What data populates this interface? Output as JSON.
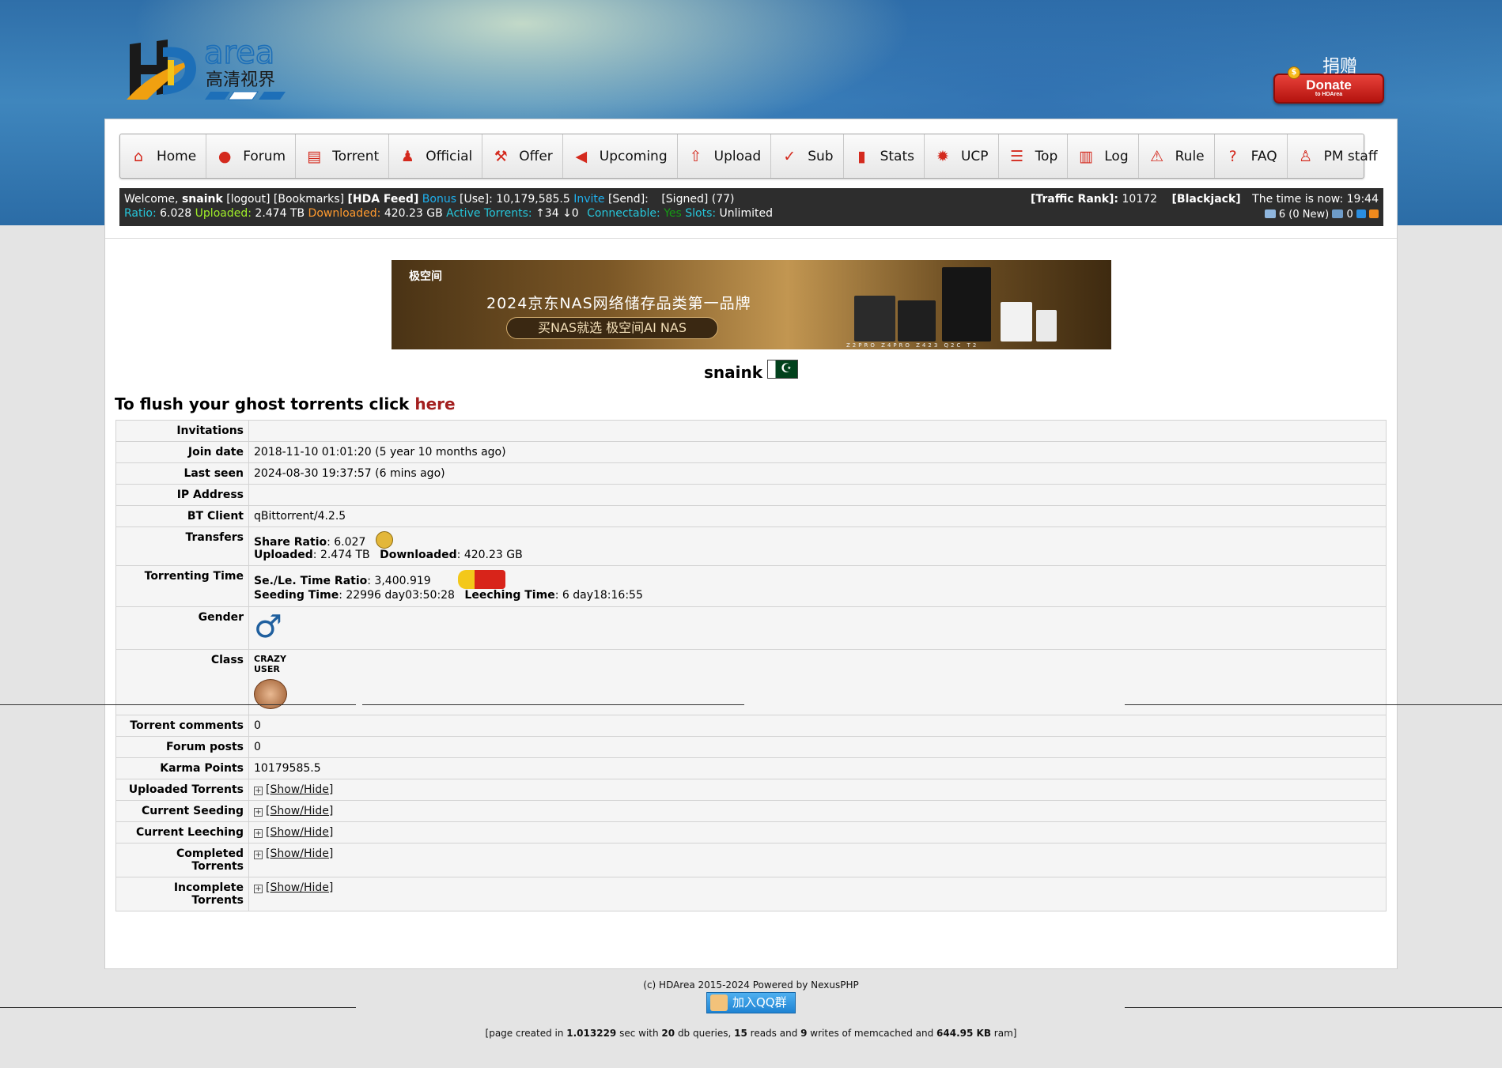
{
  "header": {
    "logo_text": "area",
    "logo_cn": "高清视界",
    "donate": {
      "cn": "捐赠",
      "label": "Donate",
      "sub": "to HDArea"
    }
  },
  "nav": [
    {
      "label": "Home",
      "icon": "home-icon"
    },
    {
      "label": "Forum",
      "icon": "chat-icon"
    },
    {
      "label": "Torrent",
      "icon": "book-icon"
    },
    {
      "label": "Official",
      "icon": "person-icon"
    },
    {
      "label": "Offer",
      "icon": "gavel-icon"
    },
    {
      "label": "Upcoming",
      "icon": "megaphone-icon"
    },
    {
      "label": "Upload",
      "icon": "upload-icon"
    },
    {
      "label": "Sub",
      "icon": "subtitle-icon"
    },
    {
      "label": "Stats",
      "icon": "chart-icon"
    },
    {
      "label": "UCP",
      "icon": "gear-icon"
    },
    {
      "label": "Top",
      "icon": "list-icon"
    },
    {
      "label": "Log",
      "icon": "log-icon"
    },
    {
      "label": "Rule",
      "icon": "warning-icon"
    },
    {
      "label": "FAQ",
      "icon": "question-icon"
    },
    {
      "label": "PM staff",
      "icon": "staff-icon"
    }
  ],
  "infobar": {
    "welcome": "Welcome,",
    "username": "snaink",
    "logout": "[logout]",
    "bookmarks": "[Bookmarks]",
    "feed": "[HDA Feed]",
    "bonus_label": "Bonus",
    "bonus_use": "[Use]: 10,179,585.5",
    "invite_label": "Invite",
    "invite_send": "[Send]:",
    "signed": "[Signed]",
    "signed_count": "(77)",
    "ratio_label": "Ratio:",
    "ratio": "6.028",
    "uploaded_label": "Uploaded:",
    "uploaded": "2.474 TB",
    "downloaded_label": "Downloaded:",
    "downloaded": "420.23 GB",
    "active_label": "Active Torrents:",
    "active_up": "↑34",
    "active_down": "↓0",
    "connectable_label": "Connectable:",
    "connectable": "Yes",
    "slots_label": "Slots:",
    "slots": "Unlimited",
    "traffic_rank_label": "[Traffic Rank]:",
    "traffic_rank": "10172",
    "blackjack": "[Blackjack]",
    "time_label": "The time is now:",
    "time": "19:44",
    "messages": "6 (0 New)",
    "messages2": "0"
  },
  "banner": {
    "brand": "极空间",
    "headline": "2024京东NAS网络储存品类第一品牌",
    "tagline": "买NAS就选 极空间AI NAS",
    "models": "Z2PRO  Z4PRO     Z423     Q2C  T2"
  },
  "profile": {
    "name": "snaink",
    "flush_text": "To flush your ghost torrents click",
    "flush_link": "here",
    "rows": {
      "invitations": {
        "label": "Invitations",
        "value": ""
      },
      "join_date": {
        "label": "Join date",
        "value": "2018-11-10 01:01:20 (5 year 10 months ago)"
      },
      "last_seen": {
        "label": "Last seen",
        "value": "2024-08-30 19:37:57 (6 mins ago)"
      },
      "ip": {
        "label": "IP Address",
        "value": ""
      },
      "bt_client": {
        "label": "BT Client",
        "value": "qBittorrent/4.2.5"
      },
      "transfers": {
        "label": "Transfers",
        "share_ratio_label": "Share Ratio",
        "share_ratio": ": 6.027",
        "uploaded_label": "Uploaded",
        "uploaded": ": 2.474 TB",
        "downloaded_label": "Downloaded",
        "downloaded": ": 420.23 GB"
      },
      "torrenting_time": {
        "label": "Torrenting Time",
        "ratio_label": "Se./Le. Time Ratio",
        "ratio": ": 3,400.919",
        "seeding_label": "Seeding Time",
        "seeding": ": 22996 day03:50:28",
        "leeching_label": "Leeching Time",
        "leeching": ": 6 day18:16:55"
      },
      "gender": {
        "label": "Gender",
        "value": "♂"
      },
      "class": {
        "label": "Class",
        "value": "CRAZY USER"
      },
      "torrent_comments": {
        "label": "Torrent comments",
        "value": "0"
      },
      "forum_posts": {
        "label": "Forum posts",
        "value": "0"
      },
      "karma": {
        "label": "Karma Points",
        "value": "10179585.5"
      },
      "uploaded_torrents": {
        "label": "Uploaded Torrents",
        "value": "[Show/Hide]"
      },
      "current_seeding": {
        "label": "Current Seeding",
        "value": "[Show/Hide]"
      },
      "current_leeching": {
        "label": "Current Leeching",
        "value": "[Show/Hide]"
      },
      "completed": {
        "label": "Completed Torrents",
        "value": "[Show/Hide]"
      },
      "incomplete": {
        "label": "Incomplete Torrents",
        "value": "[Show/Hide]"
      }
    }
  },
  "footer": {
    "copyright": "(c) HDArea 2015-2024 Powered by NexusPHP",
    "qq": "加入QQ群",
    "stats_pre": "[page created in ",
    "stats_time": "1.013229",
    "stats_mid1": " sec with ",
    "stats_queries": "20",
    "stats_mid2": " db queries, ",
    "stats_reads": "15",
    "stats_mid3": " reads and ",
    "stats_writes": "9",
    "stats_mid4": " writes of memcached and ",
    "stats_ram": "644.95 KB",
    "stats_post": " ram]"
  },
  "colors": {
    "accent_red": "#d42a1e",
    "link_red": "#a31f1f",
    "infobar_bg": "#2d2d2d"
  }
}
